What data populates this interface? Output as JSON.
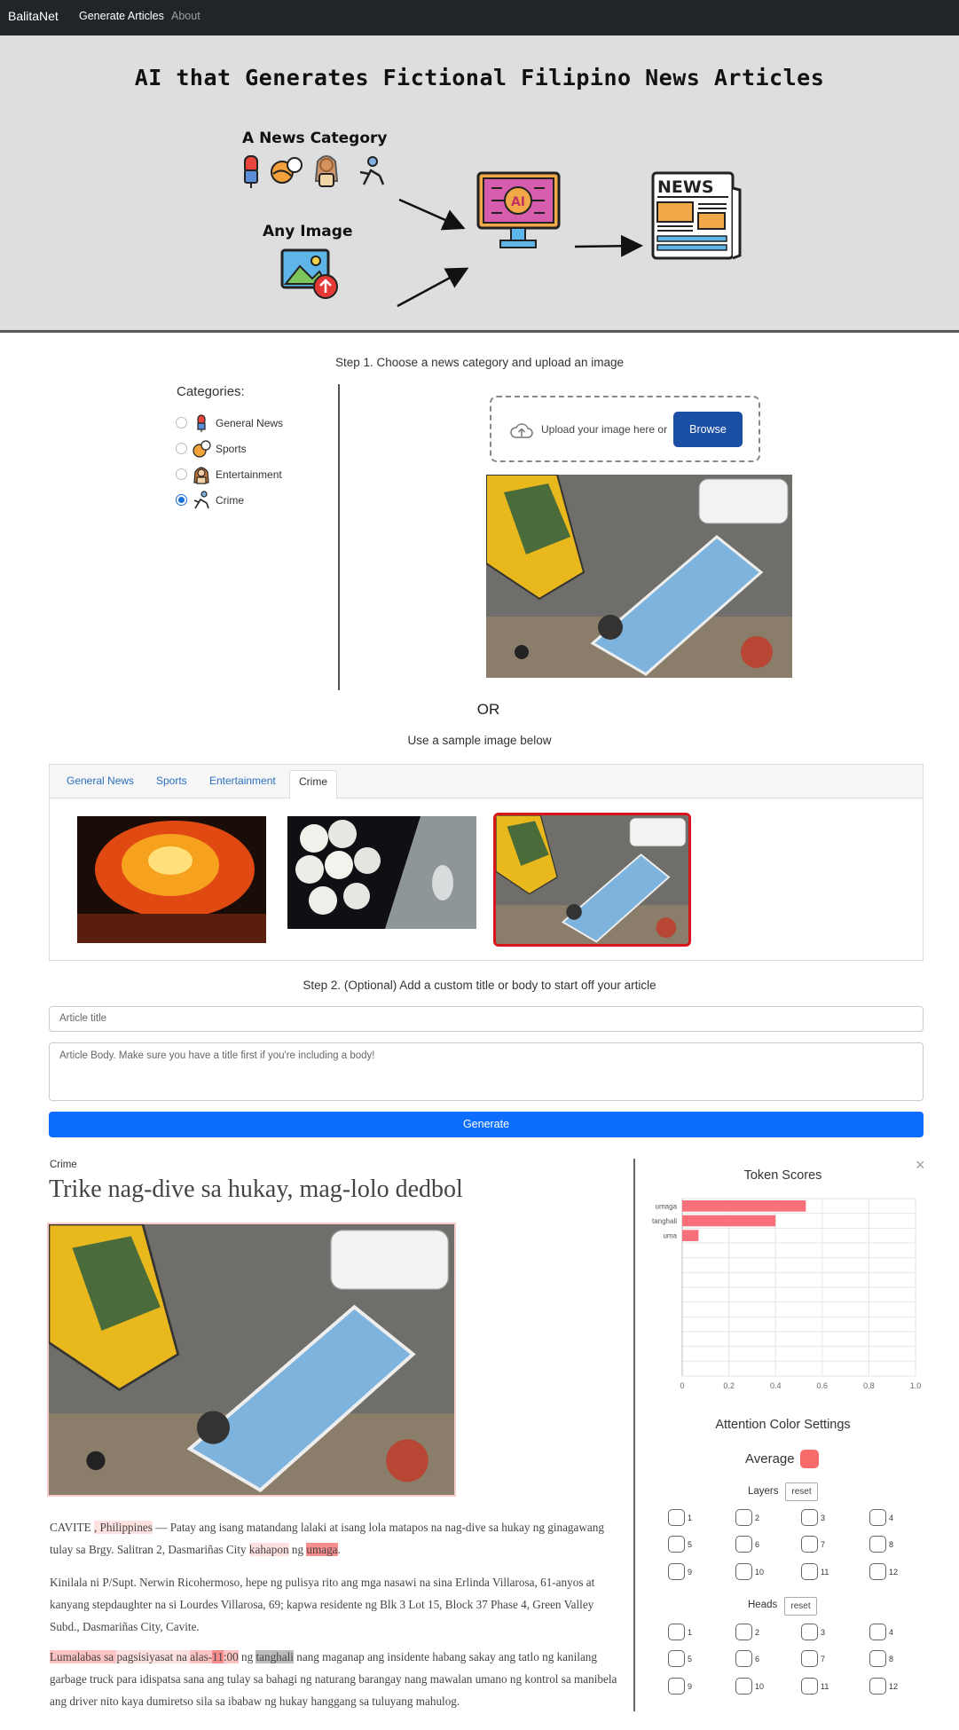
{
  "navbar": {
    "brand": "BalitaNet",
    "links": [
      "Generate Articles",
      "About"
    ]
  },
  "hero": {
    "title": "AI that Generates Fictional Filipino News Articles",
    "category_label": "A News Category",
    "image_label": "Any Image",
    "ai_label": "AI",
    "news_label": "NEWS"
  },
  "step1": {
    "title": "Step 1. Choose a news category and upload an image",
    "categories_title": "Categories:",
    "categories": [
      "General News",
      "Sports",
      "Entertainment",
      "Crime"
    ],
    "selected_category": "Crime",
    "upload_text": "Upload your image here or",
    "browse_label": "Browse",
    "or_label": "OR",
    "sample_label": "Use a sample image below"
  },
  "sample_tabs": [
    "General News",
    "Sports",
    "Entertainment",
    "Crime"
  ],
  "active_sample_tab": "Crime",
  "step2": {
    "title": "Step 2. (Optional) Add a custom title or body to start off your article",
    "title_placeholder": "Article title",
    "body_placeholder": "Article Body. Make sure you have a title first if you're including a body!",
    "generate_label": "Generate"
  },
  "article": {
    "category": "Crime",
    "title": "Trike nag-dive sa hukay, mag-lolo dedbol",
    "p1": {
      "a": "CAVITE ",
      "b": ", Philippines",
      "c": " — Patay ang isang matandang lalaki at isang lola matapos na nag-dive sa hukay ng ginagawang tulay sa Brgy. Salitran 2, Dasmariñas City ",
      "d": "kahapon",
      "e": " ng ",
      "f": "umaga",
      "g": "."
    },
    "p2": "Kinilala ni P/Supt. Nerwin Ricohermoso, hepe ng pulisya rito ang mga nasawi na sina Erlinda Villarosa, 61-anyos at  kanyang stepdaughter na si Lourdes Villarosa, 69; kapwa residente ng Blk 3 Lot 15, Block 37 Phase 4, Green Valley Subd., Dasmariñas City, Cavite.",
    "p3": {
      "a": "Lumalabas sa ",
      "b": "pagsisiyasat na ",
      "c": "alas-",
      "d": "11",
      "e": ":00",
      "f": " ng ",
      "g": "tanghali",
      "h": " nang maganap ang insidente habang sakay ang tatlo ng kanilang garbage truck para idispatsa sana ang  tulay sa bahagi ng naturang barangay nang mawalan umano ng kontrol sa manibela ang driver nito kaya dumiretso sila sa ibabaw ng hukay hanggang sa tuluyang mahulog."
    },
    "close_label": "×"
  },
  "token_scores": {
    "title": "Token Scores"
  },
  "chart_data": {
    "type": "bar",
    "orientation": "horizontal",
    "categories": [
      "umaga",
      "tanghali",
      "uma"
    ],
    "values": [
      0.53,
      0.4,
      0.07
    ],
    "xlim": [
      0,
      1.0
    ],
    "xticks": [
      "0",
      "0.2",
      "0.4",
      "0.6",
      "0.8",
      "1.0"
    ],
    "grid": true,
    "color": "#f7707a"
  },
  "attention": {
    "title": "Attention Color Settings",
    "average_label": "Average",
    "average_color": "#f76b6b",
    "layers_label": "Layers",
    "heads_label": "Heads",
    "reset_label": "reset",
    "numbers": [
      "1",
      "2",
      "3",
      "4",
      "5",
      "6",
      "7",
      "8",
      "9",
      "10",
      "11",
      "12"
    ]
  }
}
